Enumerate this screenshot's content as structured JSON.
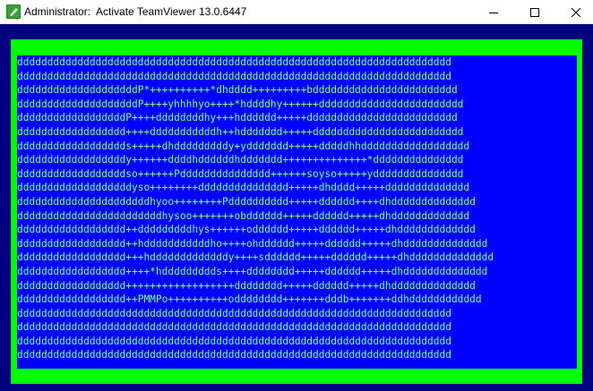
{
  "window": {
    "title": "Administrator:  Activate TeamViewer 13.0.6447",
    "icon": "console-icon",
    "controls": {
      "minimize": "minimize-icon",
      "maximize": "maximize-icon",
      "close": "close-icon"
    }
  },
  "console": {
    "colors": {
      "background": "#000080",
      "frame": "#00ff00",
      "art_background": "#0000ff",
      "text": "#7fff7f"
    },
    "lines": [
      "dddddddddddddddddddddddddddddddddddddddddddddddddddddddddddddddddddddddd",
      "dddddddddddddddddddddddddddddddddddddddddddddddddddddddddddddddddddddddd",
      "ddddddddddddddddddddP*++++++++++*dhdddd+++++++++bdddddddddddddddddddddddd",
      "ddddddddddddddddddddP++++yhhhhyo++++*hddddhy++++++dddddddddddddddddddddddd",
      "ddddddddddddddddddP++++ddddddddhy+++hdddddd+++++ddddddddddddddddddddddddd",
      "dddddddddddddddddd++++dddddddddddh++hddddddd+++++ddddddddddddddddddddddddd",
      "dddddddddddddddddds+++++dhdddddddddy+yddddddd+++++dddddhhdddddddddddddddddd",
      "ddddddddddddddddddy++++++ddddhddddddhddddddd++++++++++++++*ddddddddddddddd",
      "ddddddddddddddddddso++++++Pddddddddddddddd++++++soyso+++++yddddddddddddddd",
      "dddddddddddddddddddyso++++++++ddddddddddddddd+++++dhdddd+++++dddddddddddddd",
      "ddddddddddddddddddddddhyoo++++++++Pdddddddddd+++++dddddd++++dhdddddddddddddd",
      "ddddddddddddddddddddddddhysoo+++++++obdddddd+++++dddddd+++++dhddddddddddddd",
      "dddddddddddddddddd++dddddddddhys++++++odddddd+++++dddddd+++++dhddddddddddddd",
      "dddddddddddddddddd++hdddddddddddho++++ohdddddd+++++dddddd+++++dhdddddddddddddd",
      "dddddddddddddddddd+++hdddddddddddddy++++sdddddd+++++dddddd+++++dhdddddddddddddd",
      "dddddddddddddddddd++++*hddddddddds++++dddddddd+++++dddddd+++++dhdddddddddddddd",
      "dddddddddddddddddd++++++++++++++++++dddddddd+++++dddddd+++++dhdddddddddddddd",
      "dddddddddddddddddd++PMMPo++++++++++odddddddd+++++++dddb+++++++ddhdddddddddddd",
      "dddddddddddddddddddddddddddddddddddddddddddddddddddddddddddddddddddddddd",
      "dddddddddddddddddddddddddddddddddddddddddddddddddddddddddddddddddddddddd",
      "dddddddddddddddddddddddddddddddddddddddddddddddddddddddddddddddddddddddd",
      "dddddddddddddddddddddddddddddddddddddddddddddddddddddddddddddddddddddddd"
    ]
  }
}
